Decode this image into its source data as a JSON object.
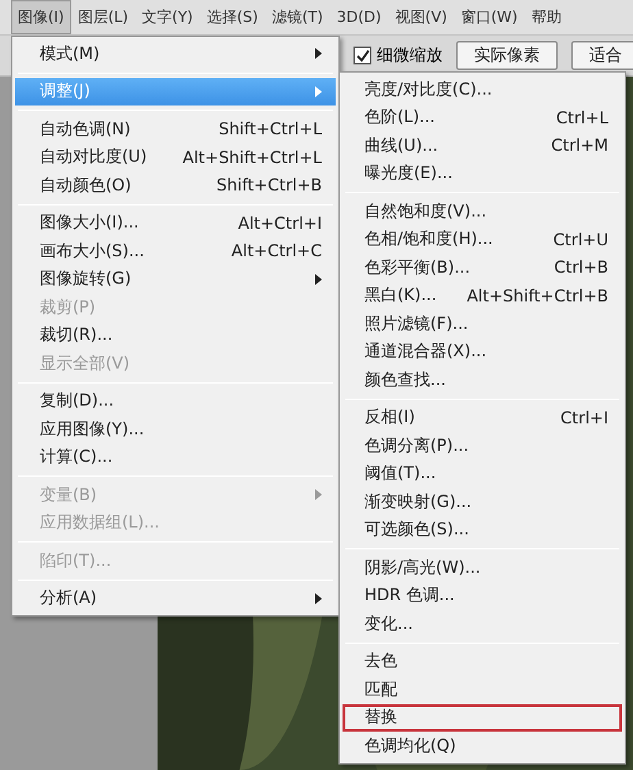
{
  "menubar": [
    {
      "label": "图像(I)",
      "selected": true
    },
    {
      "label": "图层(L)",
      "selected": false
    },
    {
      "label": "文字(Y)",
      "selected": false
    },
    {
      "label": "选择(S)",
      "selected": false
    },
    {
      "label": "滤镜(T)",
      "selected": false
    },
    {
      "label": "3D(D)",
      "selected": false
    },
    {
      "label": "视图(V)",
      "selected": false
    },
    {
      "label": "窗口(W)",
      "selected": false
    },
    {
      "label": "帮助",
      "selected": false
    }
  ],
  "options_bar": {
    "checkbox": {
      "label": "细微缩放",
      "checked": true
    },
    "buttons": [
      "实际像素",
      "适合"
    ]
  },
  "image_menu": [
    {
      "kind": "item",
      "label": "模式(M)",
      "submenu": true,
      "disabled": false,
      "selected": false
    },
    {
      "kind": "separator"
    },
    {
      "kind": "item",
      "label": "调整(J)",
      "submenu": true,
      "disabled": false,
      "selected": true
    },
    {
      "kind": "separator"
    },
    {
      "kind": "item",
      "label": "自动色调(N)",
      "shortcut": "Shift+Ctrl+L",
      "disabled": false,
      "selected": false
    },
    {
      "kind": "item",
      "label": "自动对比度(U)",
      "shortcut": "Alt+Shift+Ctrl+L",
      "disabled": false,
      "selected": false
    },
    {
      "kind": "item",
      "label": "自动颜色(O)",
      "shortcut": "Shift+Ctrl+B",
      "disabled": false,
      "selected": false
    },
    {
      "kind": "separator"
    },
    {
      "kind": "item",
      "label": "图像大小(I)...",
      "shortcut": "Alt+Ctrl+I",
      "disabled": false,
      "selected": false
    },
    {
      "kind": "item",
      "label": "画布大小(S)...",
      "shortcut": "Alt+Ctrl+C",
      "disabled": false,
      "selected": false
    },
    {
      "kind": "item",
      "label": "图像旋转(G)",
      "submenu": true,
      "disabled": false,
      "selected": false
    },
    {
      "kind": "item",
      "label": "裁剪(P)",
      "disabled": true,
      "selected": false
    },
    {
      "kind": "item",
      "label": "裁切(R)...",
      "disabled": false,
      "selected": false
    },
    {
      "kind": "item",
      "label": "显示全部(V)",
      "disabled": true,
      "selected": false
    },
    {
      "kind": "separator"
    },
    {
      "kind": "item",
      "label": "复制(D)...",
      "disabled": false,
      "selected": false
    },
    {
      "kind": "item",
      "label": "应用图像(Y)...",
      "disabled": false,
      "selected": false
    },
    {
      "kind": "item",
      "label": "计算(C)...",
      "disabled": false,
      "selected": false
    },
    {
      "kind": "separator"
    },
    {
      "kind": "item",
      "label": "变量(B)",
      "submenu": true,
      "disabled": true,
      "selected": false
    },
    {
      "kind": "item",
      "label": "应用数据组(L)...",
      "disabled": true,
      "selected": false
    },
    {
      "kind": "separator"
    },
    {
      "kind": "item",
      "label": "陷印(T)...",
      "disabled": true,
      "selected": false
    },
    {
      "kind": "separator"
    },
    {
      "kind": "item",
      "label": "分析(A)",
      "submenu": true,
      "disabled": false,
      "selected": false
    }
  ],
  "adjust_submenu": [
    {
      "kind": "item",
      "label": "亮度/对比度(C)...",
      "annotated": false
    },
    {
      "kind": "item",
      "label": "色阶(L)...",
      "shortcut": "Ctrl+L",
      "annotated": false
    },
    {
      "kind": "item",
      "label": "曲线(U)...",
      "shortcut": "Ctrl+M",
      "annotated": false
    },
    {
      "kind": "item",
      "label": "曝光度(E)...",
      "annotated": false
    },
    {
      "kind": "separator"
    },
    {
      "kind": "item",
      "label": "自然饱和度(V)...",
      "annotated": false
    },
    {
      "kind": "item",
      "label": "色相/饱和度(H)...",
      "shortcut": "Ctrl+U",
      "annotated": false
    },
    {
      "kind": "item",
      "label": "色彩平衡(B)...",
      "shortcut": "Ctrl+B",
      "annotated": false
    },
    {
      "kind": "item",
      "label": "黑白(K)...",
      "shortcut": "Alt+Shift+Ctrl+B",
      "annotated": false
    },
    {
      "kind": "item",
      "label": "照片滤镜(F)...",
      "annotated": false
    },
    {
      "kind": "item",
      "label": "通道混合器(X)...",
      "annotated": false
    },
    {
      "kind": "item",
      "label": "颜色查找...",
      "annotated": false
    },
    {
      "kind": "separator"
    },
    {
      "kind": "item",
      "label": "反相(I)",
      "shortcut": "Ctrl+I",
      "annotated": false
    },
    {
      "kind": "item",
      "label": "色调分离(P)...",
      "annotated": false
    },
    {
      "kind": "item",
      "label": "阈值(T)...",
      "annotated": false
    },
    {
      "kind": "item",
      "label": "渐变映射(G)...",
      "annotated": false
    },
    {
      "kind": "item",
      "label": "可选颜色(S)...",
      "annotated": false
    },
    {
      "kind": "separator"
    },
    {
      "kind": "item",
      "label": "阴影/高光(W)...",
      "annotated": false
    },
    {
      "kind": "item",
      "label": "HDR 色调...",
      "annotated": false
    },
    {
      "kind": "item",
      "label": "变化...",
      "annotated": false
    },
    {
      "kind": "separator"
    },
    {
      "kind": "item",
      "label": "去色",
      "annotated": false
    },
    {
      "kind": "item",
      "label": "匹配",
      "annotated": false
    },
    {
      "kind": "item",
      "label": "替换",
      "annotated": true
    },
    {
      "kind": "item",
      "label": "色调均化(Q)",
      "annotated": false
    }
  ]
}
